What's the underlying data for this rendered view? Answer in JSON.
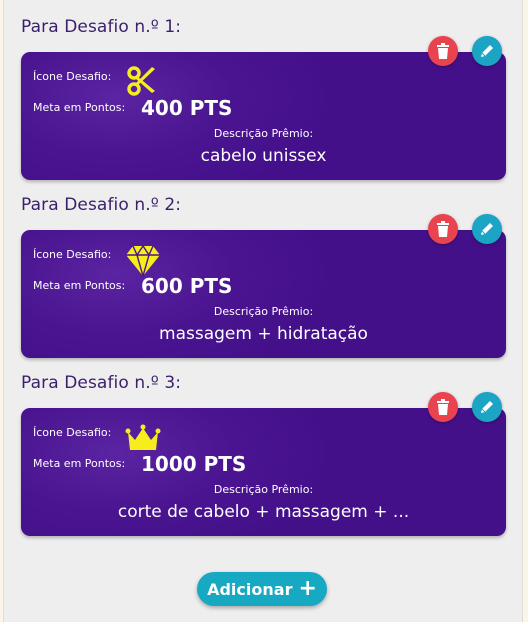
{
  "challenges": [
    {
      "section_title": "Para Desafio n.º 1:",
      "icon_label": "Ícone Desafio:",
      "icon": "scissors-icon",
      "meta_label": "Meta em Pontos:",
      "points": "400 PTS",
      "desc_label": "Descrição Prêmio:",
      "description": "cabelo unissex"
    },
    {
      "section_title": "Para Desafio n.º 2:",
      "icon_label": "Ícone Desafio:",
      "icon": "diamond-icon",
      "meta_label": "Meta em Pontos:",
      "points": "600 PTS",
      "desc_label": "Descrição Prêmio:",
      "description": "massagem + hidratação"
    },
    {
      "section_title": "Para Desafio n.º 3:",
      "icon_label": "Ícone Desafio:",
      "icon": "crown-icon",
      "meta_label": "Meta em Pontos:",
      "points": "1000 PTS",
      "desc_label": "Descrição Prêmio:",
      "description": "corte de cabelo + massagem + ..."
    }
  ],
  "add_button_label": "Adicionar",
  "colors": {
    "card": "#4a1490",
    "delete": "#e8434f",
    "edit": "#1ba4c4",
    "icon_yellow": "#f5ee1c",
    "title": "#3b1f6b"
  }
}
